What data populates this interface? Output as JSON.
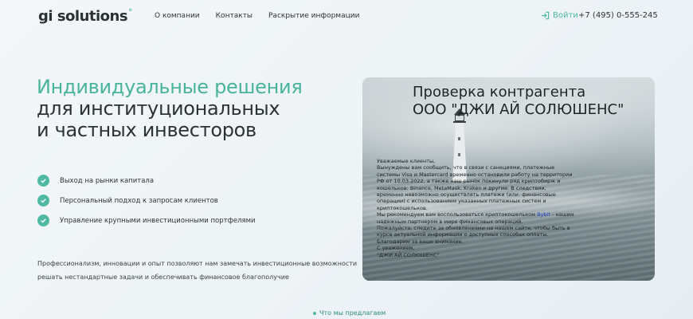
{
  "header": {
    "logo": "gi solutions",
    "nav": [
      "О компании",
      "Контакты",
      "Раскрытие информации"
    ],
    "login_label": "Войти",
    "phone": "+7 (495) 0-555-245"
  },
  "hero": {
    "title_accent": "Индивидуальные решения",
    "title_line2": "для институциональных",
    "title_line3": "и частных инвесторов"
  },
  "features": [
    "Выход на рынки капитала",
    "Персональный подход к запросам клиентов",
    "Управление крупными инвестиционными портфелями"
  ],
  "description": [
    "Профессионализм, инновации и опыт позволяют нам замечать инвестиционные возможности",
    "решать нестандартные задачи и обеспечивать финансовое благополучие"
  ],
  "more_label": "Что мы предлагаем",
  "card": {
    "title1": "Проверка контрагента",
    "title2": "ООО \"ДЖИ АЙ СОЛЮШЕНС\"",
    "lines": [
      "Уважаемые клиенты,",
      "Вынуждены вам сообщить, что в связи с санкциями, платежные",
      "системы Visa и Mastercard временно остановили работу на территории",
      "РФ от 10.03.2022, а также наш рынок покинули ряд криптобирж и",
      "кошельков: Binance, MetaMask, Kraken и другие. В следствии,",
      "временно невозможно осуществлять платежи (или: финансовые",
      "операции) с использованием указанных платежных систем и",
      "криптокошельков."
    ],
    "rec_prefix": "Мы рекомендуем вам воспользоваться криптокошельком ",
    "rec_link": "Bybit",
    "rec_suffix": " - нашим",
    "lines2": [
      "надежным партнером в мире финансовых операций.",
      "Пожалуйста, следите за обновлениями на нашем сайте, чтобы быть в",
      "курсе актуальной информации о доступных способах оплаты.",
      "Благодарим за ваше внимание.",
      "С уважением,",
      "\"ДЖИ АЙ СОЛЮШЕНС\""
    ]
  },
  "colors": {
    "accent": "#4fb9a2",
    "text": "#2c3336",
    "link": "#1a3cc8"
  }
}
